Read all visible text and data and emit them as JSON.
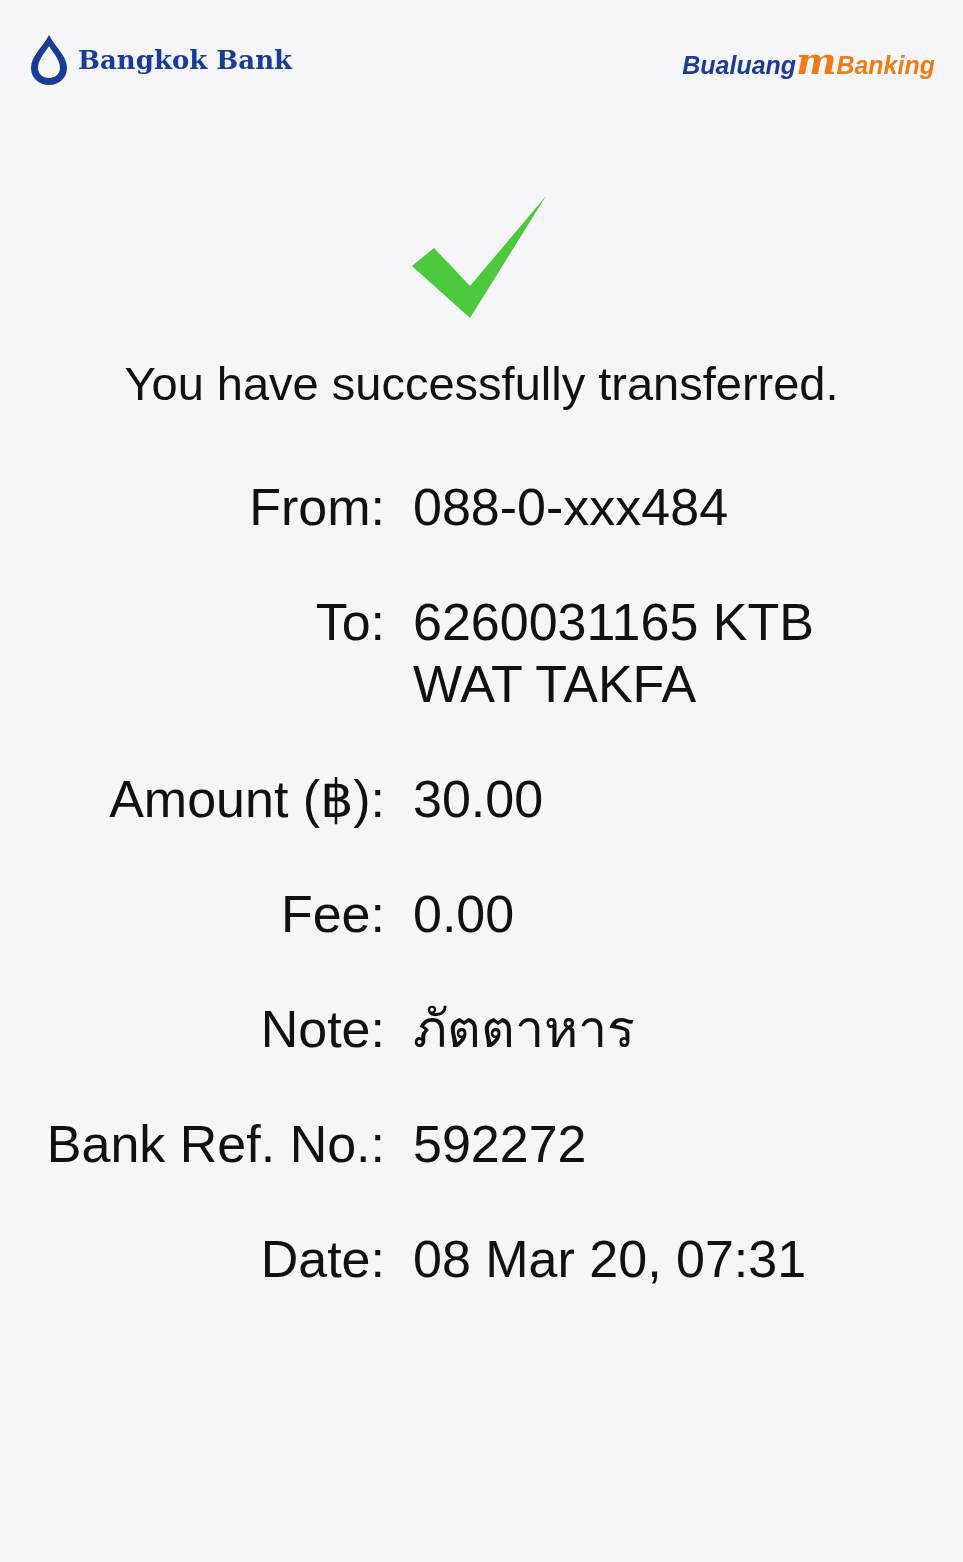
{
  "header": {
    "bank_name": "Bangkok Bank",
    "app_name_left": "Bualuang",
    "app_name_mark": "m",
    "app_name_right": "Banking"
  },
  "message": "You have successfully transferred.",
  "details": [
    {
      "label": "From:",
      "value": "088-0-xxx484"
    },
    {
      "label": "To:",
      "value": "6260031165 KTB WAT TAKFA"
    },
    {
      "label": "Amount (฿):",
      "value": "30.00"
    },
    {
      "label": "Fee:",
      "value": "0.00"
    },
    {
      "label": "Note:",
      "value": "ภัตตาหาร"
    },
    {
      "label": "Bank Ref. No.:",
      "value": "592272"
    },
    {
      "label": "Date:",
      "value": "08 Mar 20, 07:31"
    }
  ]
}
